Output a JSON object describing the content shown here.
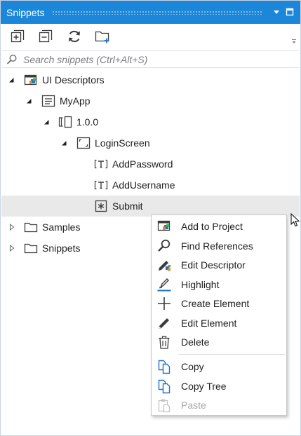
{
  "panel": {
    "title": "Snippets"
  },
  "toolbar": {
    "expand_all": "expand-all",
    "collapse_all": "collapse-all",
    "refresh": "refresh",
    "new_folder": "new-folder"
  },
  "search": {
    "placeholder": "Search snippets (Ctrl+Alt+S)",
    "value": ""
  },
  "tree": {
    "nodes": [
      {
        "label": "UI Descriptors",
        "icon": "ui-descriptors-icon",
        "expanded": true
      },
      {
        "label": "MyApp",
        "icon": "app-icon",
        "expanded": true
      },
      {
        "label": "1.0.0",
        "icon": "version-icon",
        "expanded": true
      },
      {
        "label": "LoginScreen",
        "icon": "screen-icon",
        "expanded": true
      },
      {
        "label": "AddPassword",
        "icon": "text-element-icon"
      },
      {
        "label": "AddUsername",
        "icon": "text-element-icon"
      },
      {
        "label": "Submit",
        "icon": "button-element-icon",
        "selected": true
      },
      {
        "label": "Samples",
        "icon": "folder-icon",
        "expanded": false
      },
      {
        "label": "Snippets",
        "icon": "folder-icon",
        "expanded": false
      }
    ]
  },
  "context_menu": {
    "items": [
      {
        "label": "Add to Project",
        "icon": "add-to-project-icon",
        "enabled": true
      },
      {
        "label": "Find References",
        "icon": "magnifier-icon",
        "enabled": true
      },
      {
        "label": "Edit Descriptor",
        "icon": "edit-descriptor-icon",
        "enabled": true
      },
      {
        "label": "Highlight",
        "icon": "highlight-icon",
        "enabled": true
      },
      {
        "label": "Create Element",
        "icon": "plus-icon",
        "enabled": true
      },
      {
        "label": "Edit Element",
        "icon": "pencil-icon",
        "enabled": true
      },
      {
        "label": "Delete",
        "icon": "trash-icon",
        "enabled": true
      },
      {
        "label": "Copy",
        "icon": "copy-icon",
        "enabled": true
      },
      {
        "label": "Copy Tree",
        "icon": "copy-tree-icon",
        "enabled": true
      },
      {
        "label": "Paste",
        "icon": "paste-icon",
        "enabled": false
      }
    ]
  },
  "colors": {
    "titlebar": "#1c86d8",
    "accent_blue": "#1c72c7",
    "selection": "#e9e9ea",
    "disabled_text": "#a8a8a8"
  }
}
